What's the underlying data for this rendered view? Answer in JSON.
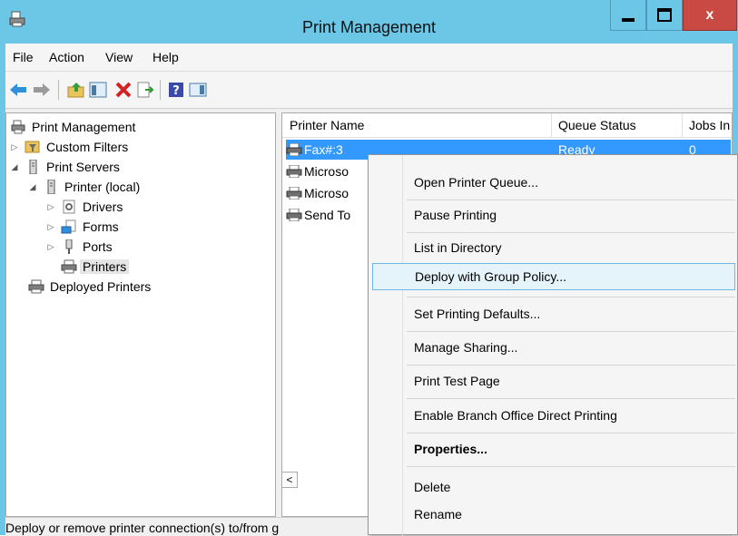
{
  "window": {
    "title": "Print Management",
    "close_glyph": "x"
  },
  "menu": [
    "File",
    "Action",
    "View",
    "Help"
  ],
  "tree": {
    "root": "Print Management",
    "custom_filters": "Custom Filters",
    "print_servers": "Print Servers",
    "printer_local": "Printer (local)",
    "drivers": "Drivers",
    "forms": "Forms",
    "ports": "Ports",
    "printers": "Printers",
    "deployed_printers": "Deployed Printers"
  },
  "list": {
    "columns": [
      "Printer Name",
      "Queue Status",
      "Jobs In"
    ],
    "rows": [
      {
        "name": "Fax#:3",
        "status": "Ready",
        "jobs": "0"
      },
      {
        "name": "Microso",
        "status": "",
        "jobs": ""
      },
      {
        "name": "Microso",
        "status": "",
        "jobs": ""
      },
      {
        "name": "Send To",
        "status": "",
        "jobs": ""
      }
    ],
    "scroll_left_glyph": "<"
  },
  "context_menu": [
    "Open Printer Queue...",
    "Pause Printing",
    "List in Directory",
    "Deploy with Group Policy...",
    "Set Printing Defaults...",
    "Manage Sharing...",
    "Print Test Page",
    "Enable Branch Office Direct Printing",
    "Properties...",
    "Delete",
    "Rename"
  ],
  "status_text": "Deploy or remove printer connection(s) to/from g",
  "colors": {
    "title_bar": "#6cc6e6",
    "selection": "#3399ff",
    "close": "#c94a43",
    "menu_highlight": "#e5f3fb"
  },
  "icons": [
    "app-printer-icon",
    "back-arrow-icon",
    "forward-arrow-icon",
    "up-folder-icon",
    "show-hide-tree-icon",
    "delete-x-icon",
    "export-list-icon",
    "help-icon",
    "action-pane-icon",
    "filter-icon",
    "server-icon",
    "printer-icon",
    "drivers-icon",
    "forms-icon",
    "ports-icon"
  ]
}
